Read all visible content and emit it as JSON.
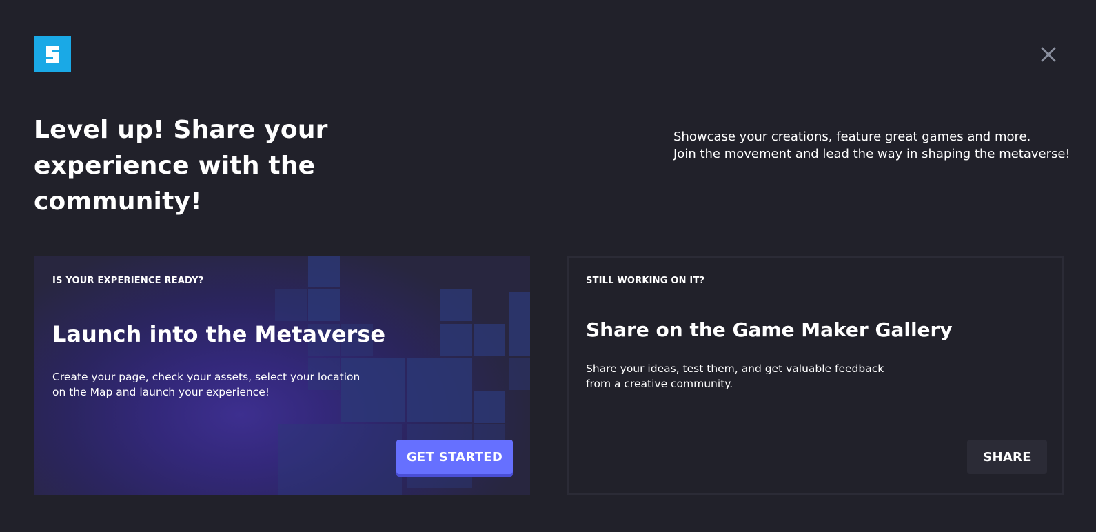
{
  "brand": {
    "logo_icon": "sandbox-s-logo",
    "logo_color": "#1aa9e6"
  },
  "header": {
    "close_icon": "close-icon",
    "headline": "Level up! Share your experience with the community!",
    "intro_line_1": "Showcase your creations, feature great games and more.",
    "intro_line_2": "Join the movement and lead the way in shaping the metaverse!"
  },
  "cards": {
    "launch": {
      "eyebrow": "IS YOUR EXPERIENCE READY?",
      "title": "Launch into the Metaverse",
      "description": "Create your page, check your assets, select your location on the Map and launch your experience!",
      "button_label": "GET STARTED",
      "button_color": "#6670ff"
    },
    "share": {
      "eyebrow": "STILL WORKING ON IT?",
      "title": "Share on the Game Maker Gallery",
      "description": "Share your ideas, test them, and get valuable feedback from a creative community.",
      "button_label": "SHARE"
    }
  },
  "colors": {
    "background": "#21212a",
    "card_border": "#2b2b36",
    "launch_gradient": "#3d2f8f"
  }
}
